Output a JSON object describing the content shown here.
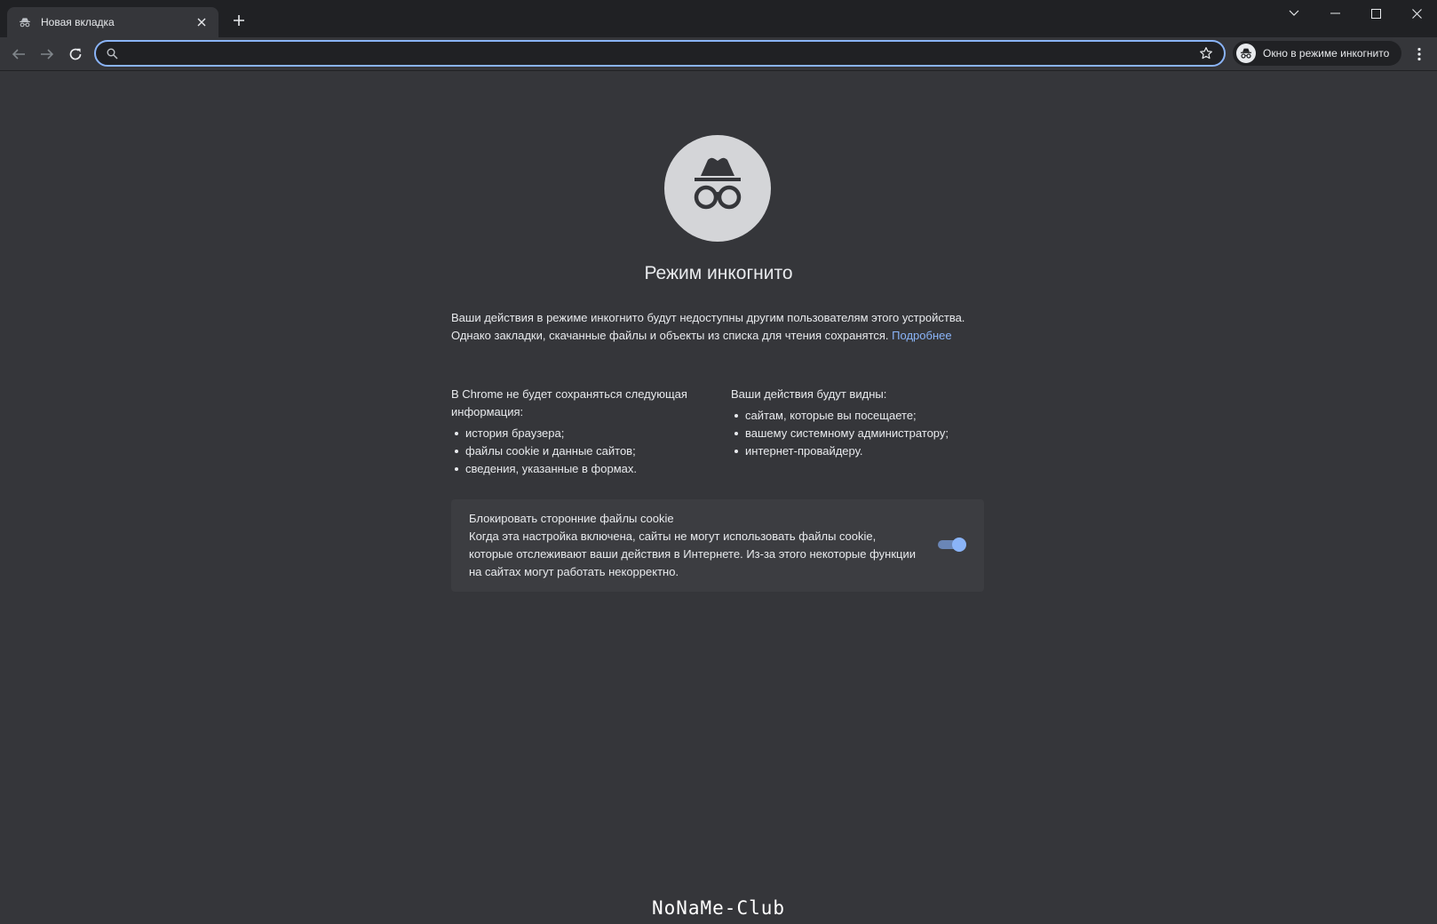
{
  "window": {
    "tab_title": "Новая вкладка",
    "controls": [
      "tab-search-icon",
      "minimize-icon",
      "maximize-icon",
      "close-icon"
    ]
  },
  "toolbar": {
    "omnibox_value": "",
    "profile_chip_label": "Окно в режиме инкогнито"
  },
  "page": {
    "title": "Режим инкогнито",
    "intro_text": "Ваши действия в режиме инкогнито будут недоступны другим пользователям этого устройства. Однако закладки, скачанные файлы и объекты из списка для чтения сохранятся.",
    "learn_more_link": "Подробнее",
    "not_saved": {
      "heading": "В Chrome не будет сохраняться следующая информация:",
      "items": [
        "история браузера;",
        "файлы cookie и данные сайтов;",
        "сведения, указанные в формах."
      ]
    },
    "visible_to": {
      "heading": "Ваши действия будут видны:",
      "items": [
        "сайтам, которые вы посещаете;",
        "вашему системному администратору;",
        "интернет-провайдеру."
      ]
    },
    "cookie_card": {
      "title": "Блокировать сторонние файлы cookie",
      "description": "Когда эта настройка включена, сайты не могут использовать файлы cookie, которые отслеживают ваши действия в Интернете. Из-за этого некоторые функции на сайтах могут работать некорректно.",
      "toggle_on": true
    },
    "watermark": "NoNaMe-Club"
  },
  "colors": {
    "background": "#35363a",
    "titlebar": "#202124",
    "accent": "#8ab4f8",
    "text": "#e8eaed"
  }
}
